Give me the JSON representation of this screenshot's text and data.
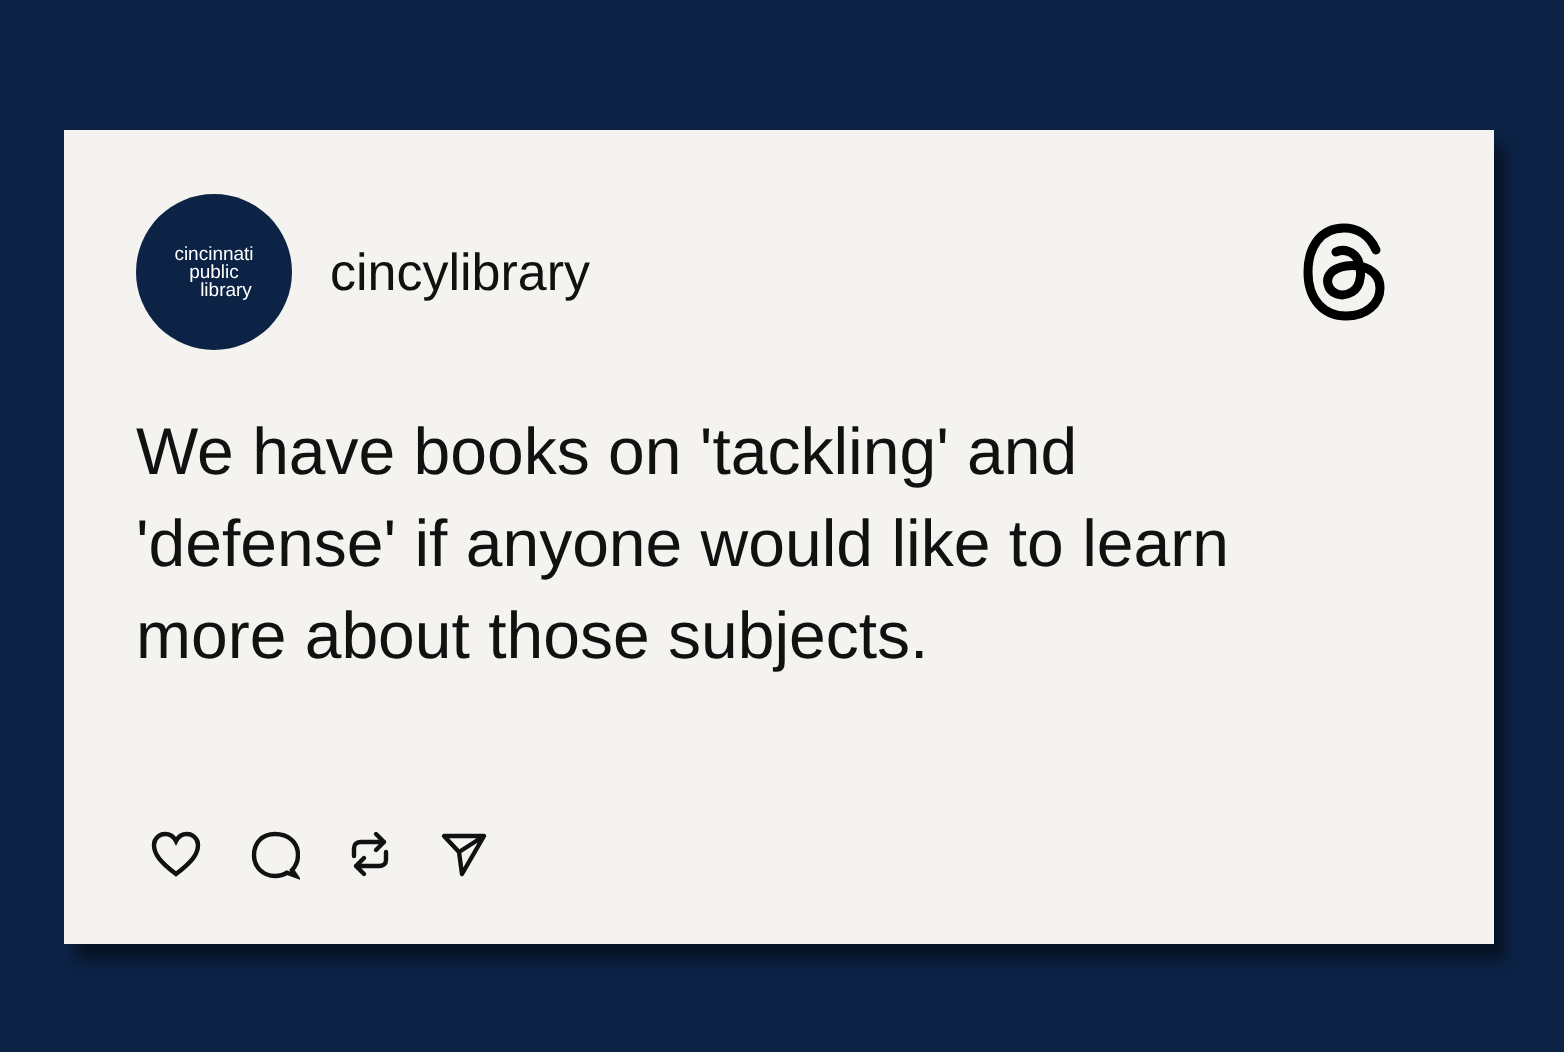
{
  "post": {
    "avatar_text": [
      "cincinnati",
      "public",
      "library"
    ],
    "username": "cincylibrary",
    "body": "We have books on 'tackling' and 'defense' if anyone would like to learn more about those subjects."
  }
}
